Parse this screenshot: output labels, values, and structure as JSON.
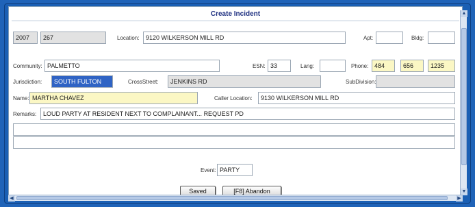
{
  "title": "Create Incident",
  "row1": {
    "year": "2007",
    "number": "267",
    "location_label": "Location:",
    "location": "9120 WILKERSON MILL RD",
    "apt_label": "Apt:",
    "apt": "",
    "bldg_label": "Bldg:",
    "bldg": ""
  },
  "row2": {
    "community_label": "Community:",
    "community": "PALMETTO",
    "esn_label": "ESN:",
    "esn": "33",
    "lang_label": "Lang:",
    "lang": "",
    "phone_label": "Phone:",
    "phone_area": "484",
    "phone_prefix": "656",
    "phone_line": "1235"
  },
  "row3": {
    "jurisdiction_label": "Jurisdiction:",
    "jurisdiction": "SOUTH FULTON",
    "crossstreet_label": "CrossStreet:",
    "crossstreet": "JENKINS RD",
    "subdivision_label": "SubDivision:",
    "subdivision": ""
  },
  "row4": {
    "name_label": "Name:",
    "name": "MARTHA CHAVEZ",
    "caller_location_label": "Caller Location:",
    "caller_location": "9130 WILKERSON MILL RD"
  },
  "row5": {
    "remarks_label": "Remarks:",
    "remarks": "LOUD PARTY AT RESIDENT NEXT TO COMPLAINANT... REQUEST PD",
    "remarks_line2": "",
    "remarks_line3": ""
  },
  "event": {
    "label": "Event:",
    "value": "PARTY"
  },
  "buttons": {
    "saved": "Saved",
    "abandon": "[F8] Abandon"
  },
  "scroll": {
    "up": "▲",
    "down": "▼",
    "left": "◀",
    "right": "▶"
  }
}
